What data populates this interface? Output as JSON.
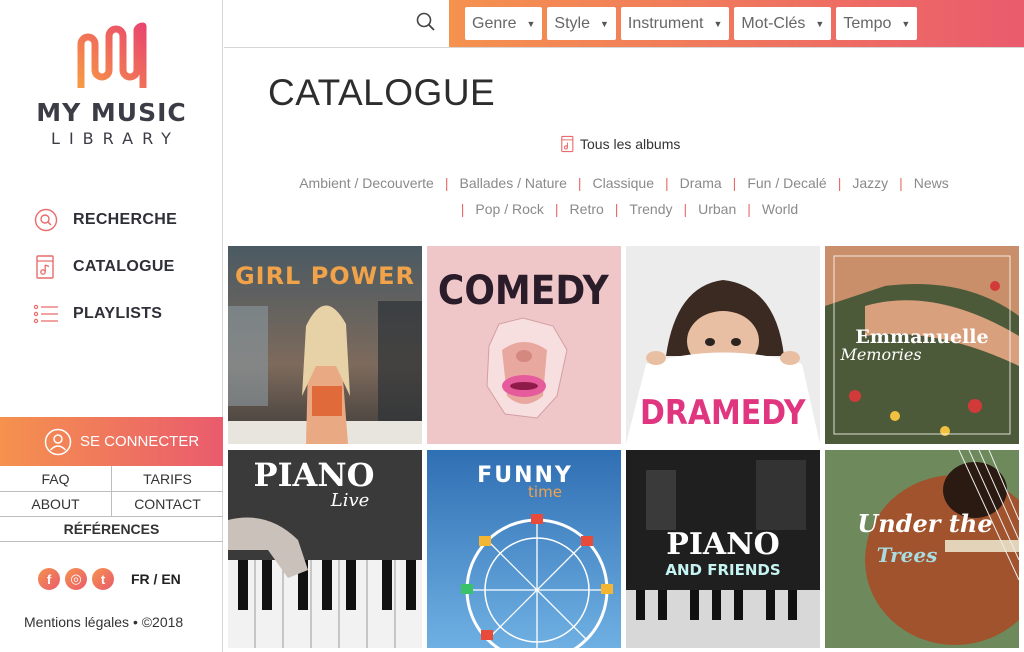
{
  "brand": {
    "title": "MY MUSIC",
    "subtitle": "LIBRARY"
  },
  "nav": [
    {
      "label": "RECHERCHE",
      "icon": "search-circle-icon"
    },
    {
      "label": "CATALOGUE",
      "icon": "music-file-icon"
    },
    {
      "label": "PLAYLISTS",
      "icon": "list-icon"
    }
  ],
  "account": {
    "connect_label": "SE CONNECTER",
    "icon": "user-circle-icon"
  },
  "links": {
    "faq": "FAQ",
    "tarifs": "TARIFS",
    "about": "ABOUT",
    "contact": "CONTACT",
    "references": "RÉFÉRENCES"
  },
  "social": {
    "facebook": "f",
    "instagram": "◎",
    "twitter": "t",
    "lang": "FR / EN"
  },
  "legal": "Mentions légales • ©2018",
  "filters": [
    {
      "label": "Genre"
    },
    {
      "label": "Style"
    },
    {
      "label": "Instrument"
    },
    {
      "label": "Mot-Clés"
    },
    {
      "label": "Tempo"
    }
  ],
  "page": {
    "title": "CATALOGUE",
    "all_albums": "Tous les albums"
  },
  "genres_row1": [
    "Ambient / Decouverte",
    "Ballades / Nature",
    "Classique",
    "Drama",
    "Fun / Decalé",
    "Jazzy",
    "News"
  ],
  "genres_row2": [
    "Pop / Rock",
    "Retro",
    "Trendy",
    "Urban",
    "World"
  ],
  "albums": [
    {
      "title": "GIRL POWER",
      "sub": ""
    },
    {
      "title": "COMEDY",
      "sub": ""
    },
    {
      "title": "DRAMEDY",
      "sub": ""
    },
    {
      "title": "Emmanuelle",
      "sub": "Memories"
    },
    {
      "title": "PIANO",
      "sub": "Live"
    },
    {
      "title": "FUNNY",
      "sub": "time"
    },
    {
      "title": "PIANO",
      "sub": "AND FRIENDS"
    },
    {
      "title": "Under the",
      "sub": "Trees"
    }
  ],
  "colors": {
    "accent_start": "#f5924e",
    "accent_end": "#ea5b6d",
    "separator": "#ea6b6b"
  }
}
